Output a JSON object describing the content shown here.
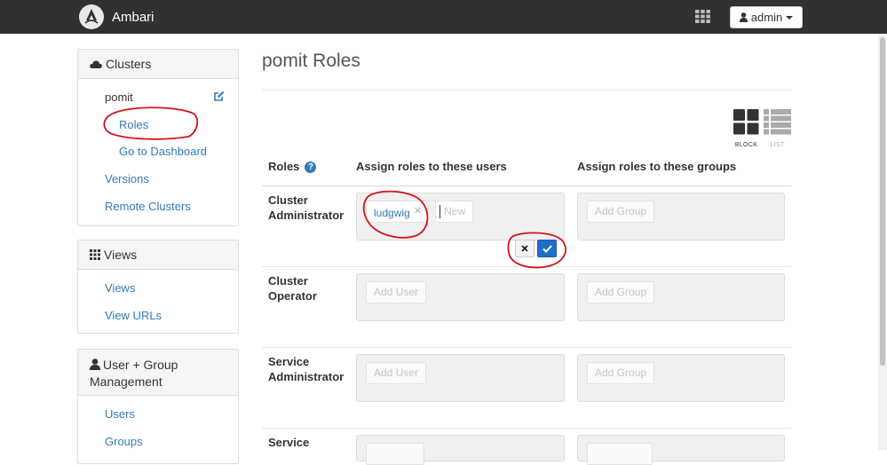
{
  "navbar": {
    "brand": "Ambari",
    "user_label": "admin"
  },
  "sidebar": {
    "clusters": {
      "heading": "Clusters",
      "cluster_name": "pomit",
      "items": [
        "Roles",
        "Go to Dashboard",
        "Versions",
        "Remote Clusters"
      ]
    },
    "views": {
      "heading": "Views",
      "items": [
        "Views",
        "View URLs"
      ]
    },
    "user_group": {
      "heading_line1": "User + Group",
      "heading_line2": "Management",
      "items": [
        "Users",
        "Groups"
      ]
    }
  },
  "main": {
    "title": "pomit Roles",
    "view_toggle": {
      "block": "BLOCK",
      "list": "LIST"
    },
    "columns": {
      "roles": "Roles",
      "users": "Assign roles to these users",
      "groups": "Assign roles to these groups"
    },
    "roles": [
      {
        "line1": "Cluster",
        "line2": "Administrator",
        "user_tag": "ludgwig",
        "new_placeholder": "New",
        "groups_placeholder": "Add Group"
      },
      {
        "line1": "Cluster",
        "line2": "Operator",
        "users_placeholder": "Add User",
        "groups_placeholder": "Add Group"
      },
      {
        "line1": "Service",
        "line2": "Administrator",
        "users_placeholder": "Add User",
        "groups_placeholder": "Add Group"
      },
      {
        "line1": "Service"
      }
    ]
  },
  "colors": {
    "navbar_bg": "#313131",
    "link": "#337ab7",
    "annotation_red": "#d0141c",
    "confirm_blue": "#1f6fc5"
  },
  "icons": [
    "ambari-logo-icon",
    "apps-grid-icon",
    "user-icon",
    "cloud-icon",
    "edit-icon",
    "grid-icon",
    "help-icon",
    "block-view-icon",
    "list-view-icon",
    "cancel-icon",
    "confirm-check-icon"
  ]
}
